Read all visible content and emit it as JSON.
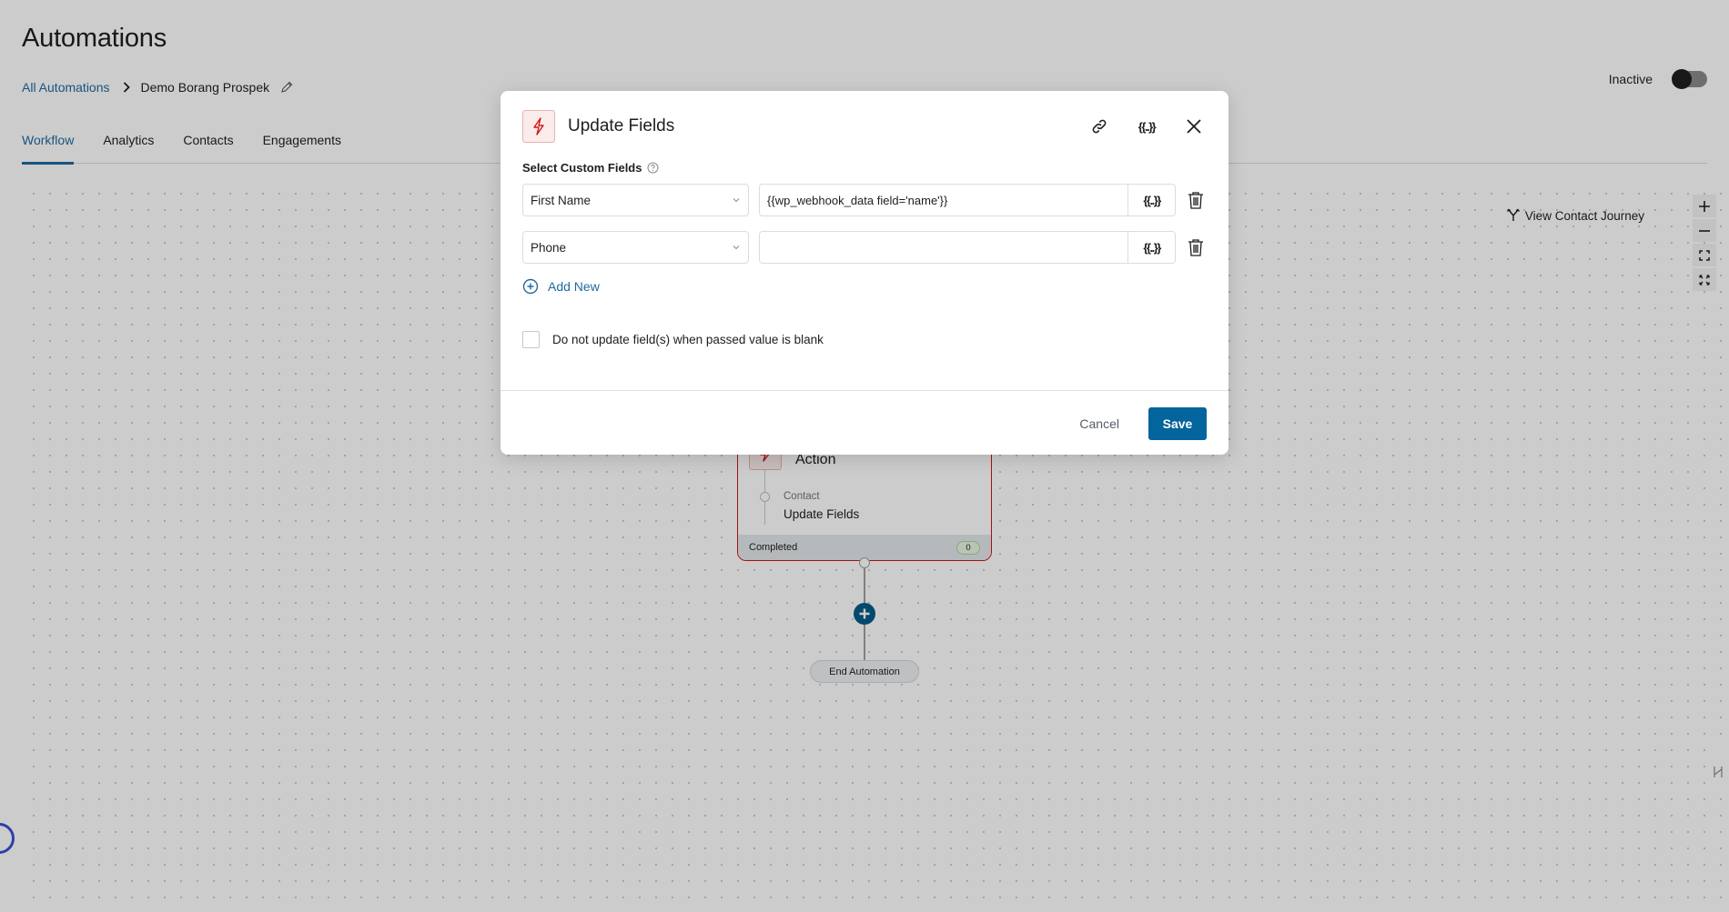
{
  "header": {
    "title": "Automations",
    "breadcrumb": {
      "root": "All Automations",
      "current": "Demo Borang Prospek"
    },
    "status_label": "Inactive",
    "status_active": false
  },
  "tabs": [
    {
      "label": "Workflow",
      "active": true
    },
    {
      "label": "Analytics",
      "active": false
    },
    {
      "label": "Contacts",
      "active": false
    },
    {
      "label": "Engagements",
      "active": false
    }
  ],
  "canvas": {
    "journey_label": "View Contact Journey",
    "zoom_controls": [
      "zoom-in",
      "zoom-out",
      "fit-view",
      "fullscreen"
    ],
    "action_node": {
      "title": "Action",
      "category": "Contact",
      "name": "Update Fields",
      "footer_status": "Completed",
      "count": "0"
    },
    "end_label": "End Automation"
  },
  "modal": {
    "title": "Update Fields",
    "header_icons": [
      "link-icon",
      "merge-tags-icon",
      "close-icon"
    ],
    "merge_tag_glyph": "{{..}}",
    "section_label": "Select Custom Fields",
    "fields": [
      {
        "field": "First Name",
        "value": "{{wp_webhook_data field='name'}}",
        "placeholder": ""
      },
      {
        "field": "Phone",
        "value": "",
        "placeholder": ""
      }
    ],
    "add_new_label": "Add New",
    "checkbox_label": "Do not update field(s) when passed value is blank",
    "checkbox_checked": false,
    "cancel_label": "Cancel",
    "save_label": "Save"
  },
  "colors": {
    "accent": "#1e6aa0",
    "primary_button": "#04649c",
    "action_border": "#cc1818",
    "action_icon_bg": "#fcebeb"
  }
}
